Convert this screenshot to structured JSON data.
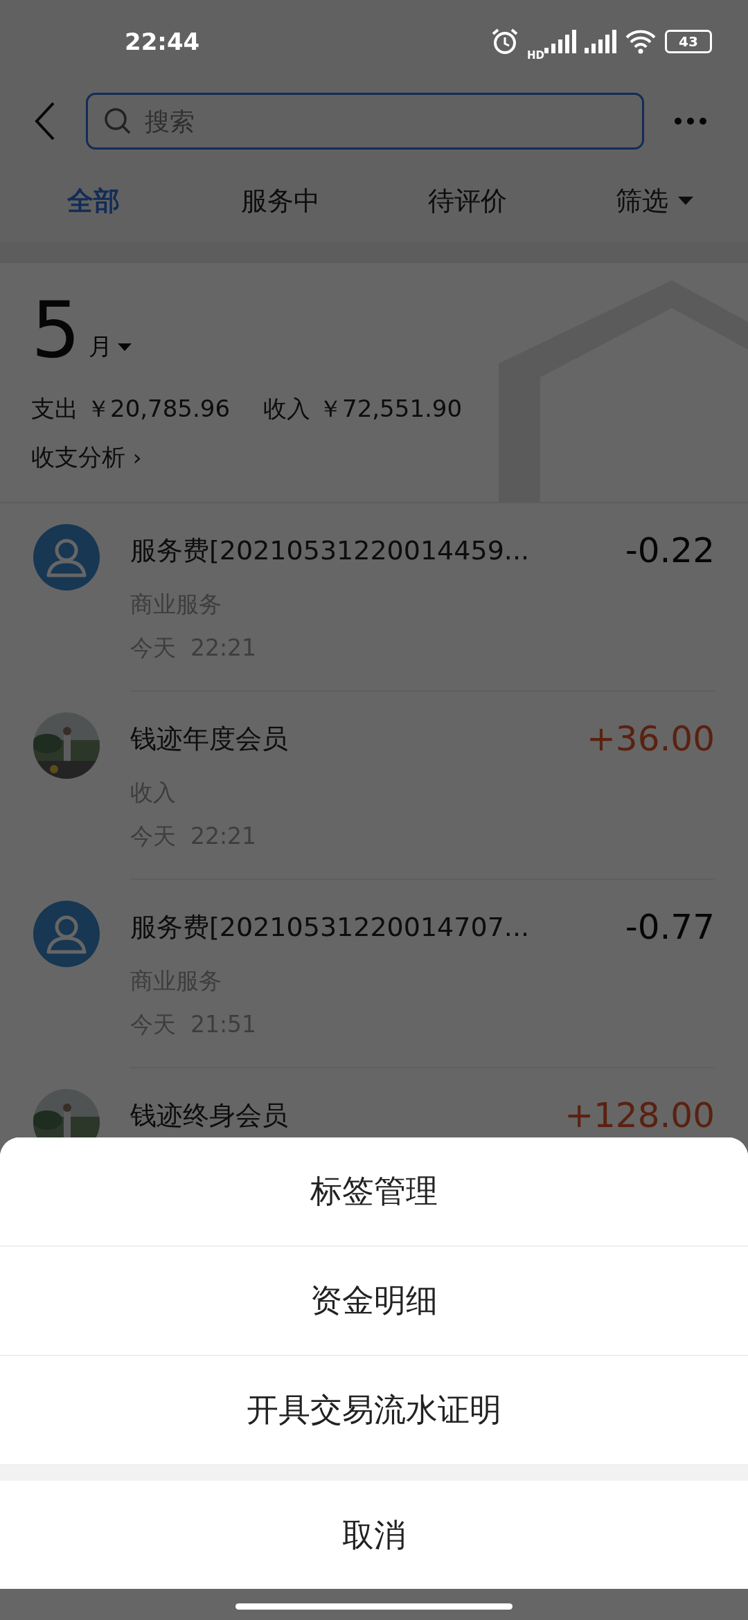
{
  "status_bar": {
    "time": "22:44",
    "network_label": "HD",
    "battery": "43"
  },
  "search": {
    "placeholder": "搜索"
  },
  "tabs": [
    {
      "label": "全部",
      "selected": true,
      "kind": "plain"
    },
    {
      "label": "服务中",
      "selected": false,
      "kind": "plain"
    },
    {
      "label": "待评价",
      "selected": false,
      "kind": "plain"
    },
    {
      "label": "筛选",
      "selected": false,
      "kind": "dropdown"
    }
  ],
  "summary": {
    "month": "5",
    "month_unit": "月",
    "expense_label": "支出",
    "expense": "￥20,785.96",
    "income_label": "收入",
    "income": "￥72,551.90",
    "analysis": "收支分析",
    "analysis_arrow": "›"
  },
  "transactions": [
    {
      "title": "服务费[20210531220014459...",
      "category": "商业服务",
      "day": "今天",
      "time": "22:21",
      "amount": "-0.22",
      "kind": "expense",
      "avatar": {
        "kind": "default"
      }
    },
    {
      "title": "钱迹年度会员",
      "category": "收入",
      "day": "今天",
      "time": "22:21",
      "amount": "+36.00",
      "kind": "income"
    },
    {
      "title": "服务费[20210531220014707...",
      "category": "商业服务",
      "day": "今天",
      "time": "21:51",
      "amount": "-0.77",
      "kind": "expense",
      "avatar": {
        "kind": "default"
      }
    },
    {
      "title": "钱迹终身会员",
      "amount": "+128.00",
      "kind": "income"
    }
  ],
  "action_sheet": {
    "options": [
      "标签管理",
      "资金明细",
      "开具交易流水证明"
    ],
    "cancel": "取消"
  }
}
